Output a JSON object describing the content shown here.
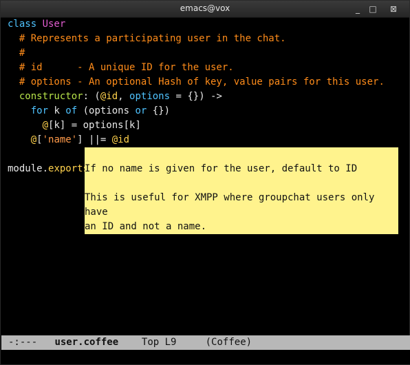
{
  "window": {
    "title": "emacs@vox"
  },
  "editor": {
    "lines": [
      [
        {
          "t": "class ",
          "c": "kw"
        },
        {
          "t": "User",
          "c": "cls"
        }
      ],
      [
        {
          "t": "  # Represents a participating user in the chat.",
          "c": "cm"
        }
      ],
      [
        {
          "t": "  #",
          "c": "cm"
        }
      ],
      [
        {
          "t": "  # id      - A unique ID for the user.",
          "c": "cm"
        }
      ],
      [
        {
          "t": "  # options - An optional Hash of key, value pairs for this user.",
          "c": "cm"
        }
      ],
      [
        {
          "t": "  constructor",
          "c": "fn"
        },
        {
          "t": ": (",
          "c": "op"
        },
        {
          "t": "@id",
          "c": "at"
        },
        {
          "t": ", ",
          "c": "op"
        },
        {
          "t": "options",
          "c": "kw"
        },
        {
          "t": " = {}) ->",
          "c": "op"
        }
      ],
      [
        {
          "t": "    for ",
          "c": "kw"
        },
        {
          "t": "k ",
          "c": "op"
        },
        {
          "t": "of ",
          "c": "kw"
        },
        {
          "t": "(options ",
          "c": "op"
        },
        {
          "t": "or ",
          "c": "kw"
        },
        {
          "t": "{})",
          "c": "op"
        }
      ],
      [
        {
          "t": "      @",
          "c": "at"
        },
        {
          "t": "[k] = options[k]",
          "c": "op"
        }
      ],
      [
        {
          "t": "    @",
          "c": "at"
        },
        {
          "t": "[",
          "c": "op"
        },
        {
          "t": "'name'",
          "c": "str"
        },
        {
          "t": "] ||= ",
          "c": "op"
        },
        {
          "t": "@id",
          "c": "at"
        }
      ],
      [
        {
          "t": "",
          "c": "op"
        }
      ],
      [
        {
          "t": "module",
          "c": "op"
        },
        {
          "t": ".",
          "c": "op"
        },
        {
          "t": "exports",
          "c": "at"
        }
      ]
    ]
  },
  "tooltip": {
    "line1": "If no name is given for the user, default to ID",
    "line2": "",
    "line3": "This is useful for XMPP where groupchat users only have",
    "line4": "an ID and not a name."
  },
  "modeline": {
    "status": "-:---",
    "buffer": "user.coffee",
    "position": "Top L9",
    "mode": "(Coffee)"
  }
}
